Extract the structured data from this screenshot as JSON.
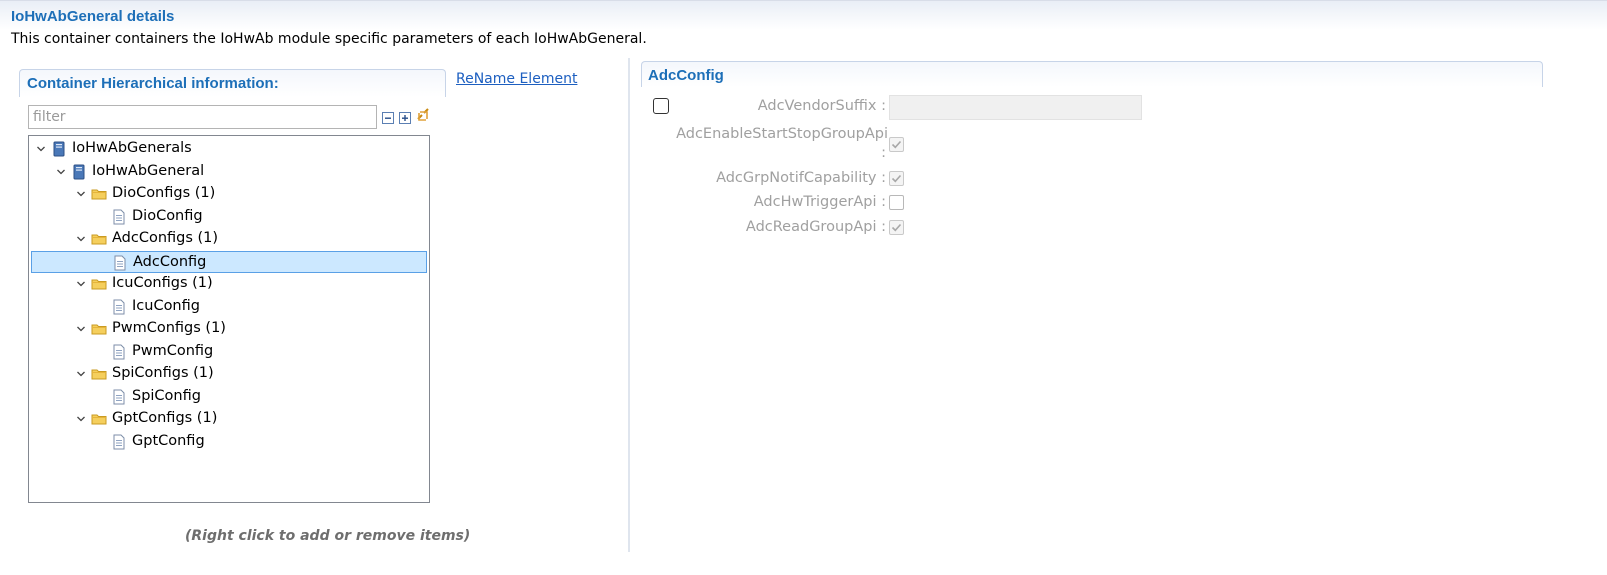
{
  "page": {
    "title": "IoHwAbGeneral details",
    "description": "This container containers the IoHwAb module specific parameters of each IoHwAbGeneral."
  },
  "left_panel": {
    "title": "Container Hierarchical information:",
    "rename_label": "ReName Element",
    "filter_placeholder": "filter",
    "filter_value": "",
    "hint": "(Right click to add or remove items)",
    "toolbar": {
      "collapse_icon": "collapse-all-icon",
      "expand_icon": "expand-all-icon",
      "link_icon": "link-with-editor-icon"
    },
    "tree": [
      {
        "label": "IoHwAbGenerals",
        "icon": "book-icon",
        "level": 0,
        "expanded": true,
        "selected": false
      },
      {
        "label": "IoHwAbGeneral",
        "icon": "book-icon",
        "level": 1,
        "expanded": true,
        "selected": false
      },
      {
        "label": "DioConfigs (1)",
        "icon": "folder-icon",
        "level": 2,
        "expanded": true,
        "selected": false
      },
      {
        "label": "DioConfig",
        "icon": "document-icon",
        "level": 3,
        "expanded": false,
        "selected": false
      },
      {
        "label": "AdcConfigs (1)",
        "icon": "folder-icon",
        "level": 2,
        "expanded": true,
        "selected": false
      },
      {
        "label": "AdcConfig",
        "icon": "document-icon",
        "level": 3,
        "expanded": false,
        "selected": true
      },
      {
        "label": "IcuConfigs (1)",
        "icon": "folder-icon",
        "level": 2,
        "expanded": true,
        "selected": false
      },
      {
        "label": "IcuConfig",
        "icon": "document-icon",
        "level": 3,
        "expanded": false,
        "selected": false
      },
      {
        "label": "PwmConfigs (1)",
        "icon": "folder-icon",
        "level": 2,
        "expanded": true,
        "selected": false
      },
      {
        "label": "PwmConfig",
        "icon": "document-icon",
        "level": 3,
        "expanded": false,
        "selected": false
      },
      {
        "label": "SpiConfigs (1)",
        "icon": "folder-icon",
        "level": 2,
        "expanded": true,
        "selected": false
      },
      {
        "label": "SpiConfig",
        "icon": "document-icon",
        "level": 3,
        "expanded": false,
        "selected": false
      },
      {
        "label": "GptConfigs (1)",
        "icon": "folder-icon",
        "level": 2,
        "expanded": true,
        "selected": false
      },
      {
        "label": "GptConfig",
        "icon": "document-icon",
        "level": 3,
        "expanded": false,
        "selected": false
      }
    ]
  },
  "right_panel": {
    "title": "AdcConfig",
    "enable_checkbox_checked": false,
    "params": [
      {
        "label": "AdcVendorSuffix :",
        "type": "text",
        "value": "",
        "enabled": false
      },
      {
        "label": "AdcEnableStartStopGroupApi",
        "label_colon": ":",
        "type": "checkbox",
        "checked": true,
        "enabled": false
      },
      {
        "label": "AdcGrpNotifCapability :",
        "type": "checkbox",
        "checked": true,
        "enabled": false
      },
      {
        "label": "AdcHwTriggerApi :",
        "type": "checkbox",
        "checked": false,
        "enabled": false
      },
      {
        "label": "AdcReadGroupApi :",
        "type": "checkbox",
        "checked": true,
        "enabled": false
      }
    ]
  },
  "colors": {
    "title_blue": "#1d6fb8",
    "link_blue": "#1d5fc0",
    "selection_bg": "#cce8ff",
    "selection_border": "#5aa0e6",
    "disabled_text": "#a0a0a0"
  }
}
